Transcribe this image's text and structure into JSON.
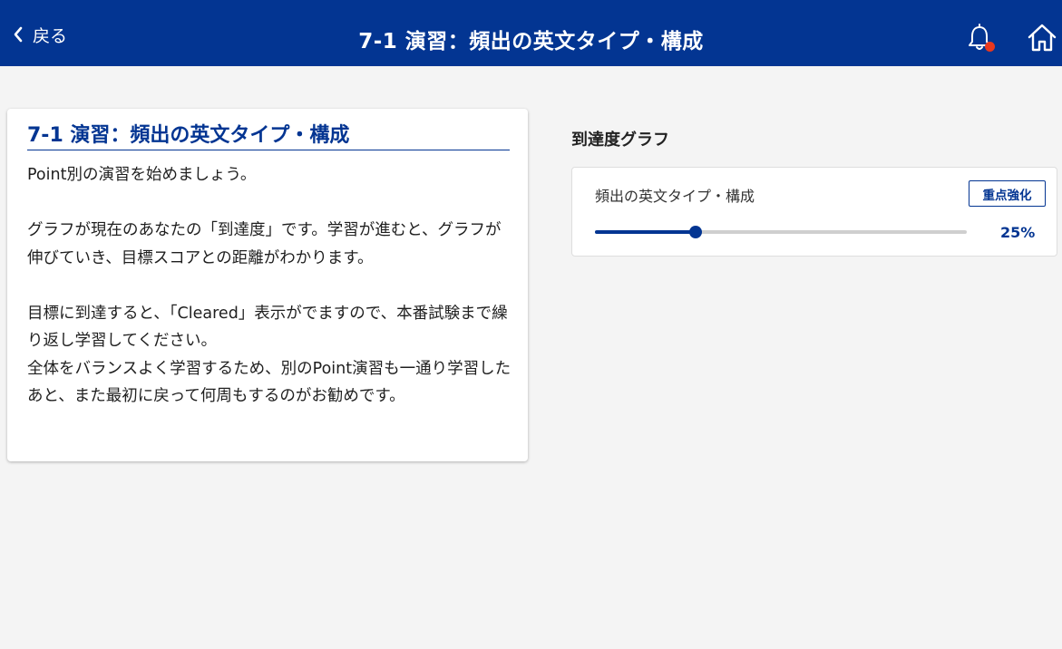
{
  "header": {
    "back_label": "戻る",
    "title": "7-1 演習：頻出の英文タイプ・構成",
    "has_notification": true
  },
  "lesson": {
    "title": "7-1 演習：頻出の英文タイプ・構成",
    "paragraphs": [
      "Point別の演習を始めましょう。",
      "",
      "グラフが現在のあなたの「到達度」です。学習が進むと、グラフが伸びていき、目標スコアとの距離がわかります。",
      "",
      "目標に到達すると、「Cleared」表示がでますので、本番試験まで繰り返し学習してください。",
      "全体をバランスよく学習するため、別のPoint演習も一通り学習したあと、また最初に戻って何周もするのがお勧めです。"
    ]
  },
  "progress": {
    "heading": "到達度グラフ",
    "topic": "頻出の英文タイプ・構成",
    "focus_button": "重点強化",
    "percent_label": "25%",
    "fraction": 0.27
  },
  "colors": {
    "brand": "#033592",
    "notification": "#e8381e",
    "track": "#cfcfcf"
  },
  "icons": {
    "back": "chevron-left-icon",
    "bell": "bell-icon",
    "home": "home-icon"
  }
}
